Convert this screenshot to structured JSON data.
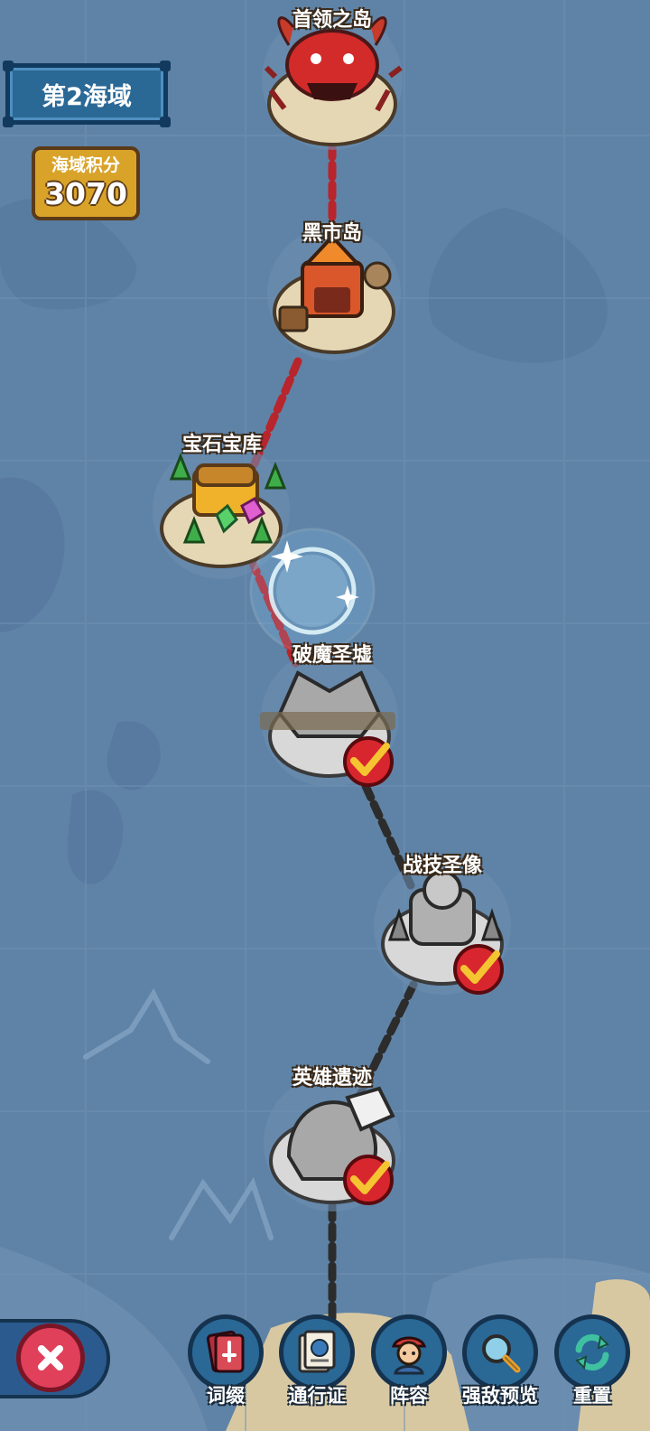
{
  "hud": {
    "zone_label": "第2海域",
    "score_label": "海域积分",
    "score_value": "3070"
  },
  "islands": [
    {
      "label": "首领之岛",
      "state": "locked"
    },
    {
      "label": "黑市岛",
      "state": "locked"
    },
    {
      "label": "宝石宝库",
      "state": "locked"
    },
    {
      "label": "破魔圣墟",
      "state": "completed"
    },
    {
      "label": "战技圣像",
      "state": "completed"
    },
    {
      "label": "英雄遗迹",
      "state": "completed"
    }
  ],
  "bottom_bar": [
    {
      "label": "词缀",
      "icon": "affix-card-icon"
    },
    {
      "label": "通行证",
      "icon": "passport-icon"
    },
    {
      "label": "阵容",
      "icon": "lineup-pirate-icon"
    },
    {
      "label": "强敌预览",
      "icon": "magnifier-icon"
    },
    {
      "label": "重置",
      "icon": "reset-arrows-icon"
    }
  ],
  "close_icon": "close-x-icon",
  "colors": {
    "sea": "#5f83a6",
    "sand": "#e6d7b4",
    "path_active": "#b8252c",
    "path_done": "#2c2c2c",
    "check_red": "#d8262e",
    "check_gold": "#f5c431"
  }
}
